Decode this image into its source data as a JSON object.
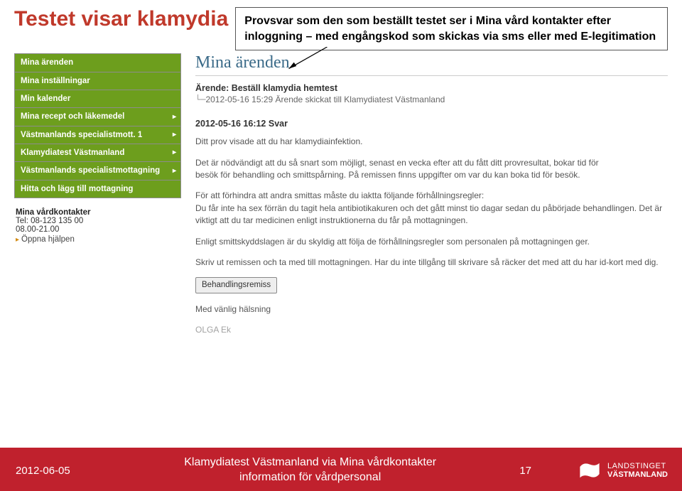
{
  "page_title": "Testet visar klamydia",
  "callout": "Provsvar som den som beställt testet ser i Mina vård kontakter efter inloggning – med engångskod som skickas via sms eller med E-legitimation",
  "sidebar": {
    "items": [
      {
        "label": "Mina ärenden",
        "arrow": false
      },
      {
        "label": "Mina inställningar",
        "arrow": false
      },
      {
        "label": "Min kalender",
        "arrow": false
      },
      {
        "label": "Mina recept och läkemedel",
        "arrow": true
      },
      {
        "label": "Västmanlands specialistmott. 1",
        "arrow": true
      },
      {
        "label": "Klamydiatest Västmanland",
        "arrow": true
      },
      {
        "label": "Västmanlands specialistmottagning",
        "arrow": true
      },
      {
        "label": "Hitta och lägg till mottagning",
        "arrow": false
      }
    ],
    "contact": {
      "heading": "Mina vårdkontakter",
      "tel": "Tel: 08-123 135 00",
      "hours": "08.00-21.00",
      "help": "Öppna hjälpen"
    }
  },
  "content": {
    "heading": "Mina ärenden",
    "case_label": "Ärende: Beställ klamydia hemtest",
    "case_line": "2012-05-16 15:29 Ärende skickat till Klamydiatest Västmanland",
    "reply_head": "2012-05-16 16:12 Svar",
    "paragraphs": [
      "Ditt prov visade att du har klamydiainfektion.",
      "Det är nödvändigt att du så snart som möjligt, senast en vecka efter att du fått ditt provresultat, bokar tid för",
      "besök för behandling och smittspårning. På remissen finns uppgifter om var du kan boka tid för besök.",
      "För att förhindra att andra smittas måste du iaktta följande förhållningsregler:",
      "Du får inte ha sex förrän du tagit hela antibiotikakuren och det gått minst tio dagar sedan du påbörjade behandlingen. Det är viktigt att du tar medicinen enligt instruktionerna du får på mottagningen.",
      "Enligt smittskyddslagen är du skyldig att följa de förhållningsregler som personalen på mottagningen ger.",
      "Skriv ut remissen och ta med till mottagningen. Har du inte tillgång till skrivare så räcker det med att du har id-kort med dig."
    ],
    "button_label": "Behandlingsremiss",
    "closing": "Med vänlig hälsning",
    "signoff": "OLGA Ek"
  },
  "footer": {
    "date": "2012-06-05",
    "center_line1": "Klamydiatest Västmanland via Mina vårdkontakter",
    "center_line2": "information för vårdpersonal",
    "page_num": "17",
    "logo_line1": "LANDSTINGET",
    "logo_line2": "VÄSTMANLAND"
  }
}
